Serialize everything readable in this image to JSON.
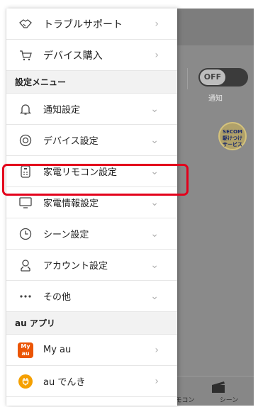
{
  "background": {
    "toggle": {
      "state_label": "OFF",
      "caption": "通知"
    },
    "badge": {
      "line1": "SECOM",
      "line2": "駆けつけ",
      "line3": "サービス"
    },
    "bottom_nav": [
      {
        "label": "モコン",
        "icon": "remote-icon"
      },
      {
        "label": "シーン",
        "icon": "clapperboard-icon"
      }
    ]
  },
  "menu": {
    "top_items": [
      {
        "label": "トラブルサポート",
        "icon": "handshake-icon"
      },
      {
        "label": "デバイス購入",
        "icon": "cart-icon"
      }
    ],
    "settings_header": "設定メニュー",
    "settings_items": [
      {
        "label": "通知設定",
        "icon": "bell-icon"
      },
      {
        "label": "デバイス設定",
        "icon": "device-icon"
      },
      {
        "label": "家電リモコン設定",
        "icon": "remote-icon"
      },
      {
        "label": "家電情報設定",
        "icon": "monitor-icon"
      },
      {
        "label": "シーン設定",
        "icon": "clock-icon"
      },
      {
        "label": "アカウント設定",
        "icon": "user-icon"
      },
      {
        "label": "その他",
        "icon": "more-icon"
      }
    ],
    "apps_header": "au アプリ",
    "app_items": [
      {
        "label": "My au",
        "icon_text_1": "My",
        "icon_text_2": "au"
      },
      {
        "label": "au でんき",
        "icon": "plug-icon"
      }
    ]
  },
  "colors": {
    "highlight": "#e3001b",
    "my_au": "#eb5505",
    "au_denki": "#f5a000"
  }
}
